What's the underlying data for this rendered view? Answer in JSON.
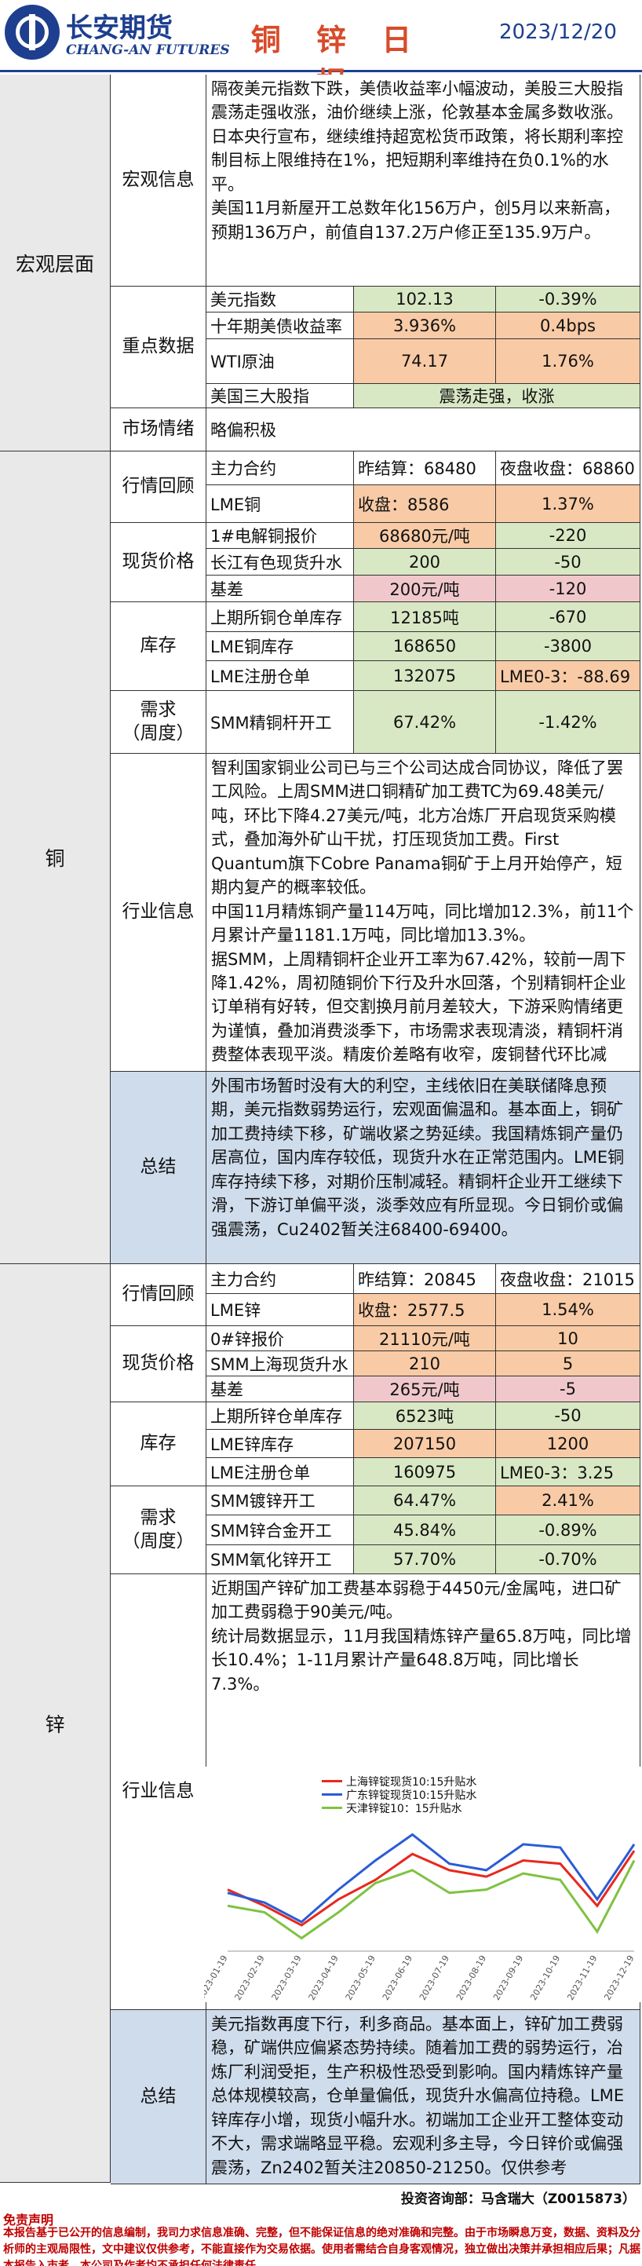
{
  "header": {
    "company_cn": "长安期货",
    "company_en": "CHANG-AN FUTURES",
    "title": "铜 锌 日 报",
    "date": "2023/12/20"
  },
  "macro": {
    "section": "宏观层面",
    "info_label": "宏观信息",
    "info_text": [
      "隔夜美元指数下跌，美债收益率小幅波动，美股三大股指震荡走强收涨，油价继续上涨，伦敦基本金属多数收涨。",
      "日本央行宣布，继续维持超宽松货币政策，将长期利率控制目标上限维持在1%，把短期利率维持在负0.1%的水平。",
      "美国11月新屋开工总数年化156万户，创5月以来新高，预期136万户，前值自137.2万户修正至135.9万户。"
    ],
    "key_label": "重点数据",
    "key_rows": [
      {
        "name": "美元指数",
        "v1": "102.13",
        "v2": "-0.39%"
      },
      {
        "name": "十年期美债收益率",
        "v1": "3.936%",
        "v2": "0.4bps"
      },
      {
        "name": "WTI原油",
        "v1": "74.17",
        "v2": "1.76%"
      }
    ],
    "stocks_name": "美国三大股指",
    "stocks_value": "震荡走强，收涨",
    "sentiment_label": "市场情绪",
    "sentiment_value": "略偏积极"
  },
  "copper": {
    "section": "铜",
    "review_label": "行情回顾",
    "review_head": [
      "主力合约",
      "昨结算：68480",
      "夜盘收盘：68860"
    ],
    "review_lme": [
      "LME铜",
      "收盘：8586",
      "1.37%"
    ],
    "spot_label": "现货价格",
    "spot_rows": [
      [
        "1#电解铜报价",
        "68680元/吨",
        "-220"
      ],
      [
        "长江有色现货升水",
        "200",
        "-50"
      ],
      [
        "基差",
        "200元/吨",
        "-120"
      ]
    ],
    "stock_label": "库存",
    "stock_rows": [
      [
        "上期所铜仓单库存",
        "12185吨",
        "-670"
      ],
      [
        "LME铜库存",
        "168650",
        "-3800"
      ],
      [
        "LME注册仓单",
        "132075",
        "LME0-3：-88.69"
      ]
    ],
    "demand_label": "需求\n（周度）",
    "demand_row": [
      "SMM精铜杆开工",
      "67.42%",
      "-1.42%"
    ],
    "industry_label": "行业信息",
    "industry_text": [
      "智利国家铜业公司已与三个公司达成合同协议，降低了罢工风险。上周SMM进口铜精矿加工费TC为69.48美元/吨，环比下降4.27美元/吨，北方冶炼厂开启现货采购模式，叠加海外矿山干扰，打压现货加工费。First Quantum旗下Cobre Panama铜矿于上月开始停产，短期内复产的概率较低。",
      "中国11月精炼铜产量114万吨，同比增加12.3%，前11个月累计产量1181.1万吨，同比增加13.3%。",
      "据SMM，上周精铜杆企业开工率为67.42%，较前一周下降1.42%，周初随铜价下行及升水回落，个别精铜杆企业订单稍有好转，但交割换月前月差较大，下游采购情绪更为谨慎，叠加消费淡季下，市场需求表现清淡，精铜杆消费整体表现平淡。精废价差略有收窄，废铜替代环比减弱。"
    ],
    "summary_label": "总结",
    "summary_text": "外围市场暂时没有大的利空，主线依旧在美联储降息预期，美元指数弱势运行，宏观面偏温和。基本面上，铜矿加工费持续下移，矿端收紧之势延续。我国精炼铜产量仍居高位，国内库存较低，现货升水在正常范围内。LME铜库存持续下移，对期价压制减轻。精铜杆企业开工继续下滑，下游订单偏平淡，淡季效应有所显现。今日铜价或偏强震荡，Cu2402暂关注68400-69400。"
  },
  "zinc": {
    "section": "锌",
    "review_label": "行情回顾",
    "review_head": [
      "主力合约",
      "昨结算：20845",
      "夜盘收盘：21015"
    ],
    "review_lme": [
      "LME锌",
      "收盘：2577.5",
      "1.54%"
    ],
    "spot_label": "现货价格",
    "spot_rows": [
      [
        "0#锌报价",
        "21110元/吨",
        "10"
      ],
      [
        "SMM上海现货升水",
        "210",
        "5"
      ],
      [
        "基差",
        "265元/吨",
        "-5"
      ]
    ],
    "stock_label": "库存",
    "stock_rows": [
      [
        "上期所锌仓单库存",
        "6523吨",
        "-50"
      ],
      [
        "LME锌库存",
        "207150",
        "1200"
      ],
      [
        "LME注册仓单",
        "160975",
        "LME0-3：3.25"
      ]
    ],
    "demand_label": "需求\n（周度）",
    "demand_rows": [
      [
        "SMM镀锌开工",
        "64.47%",
        "2.41%"
      ],
      [
        "SMM锌合金开工",
        "45.84%",
        "-0.89%"
      ],
      [
        "SMM氧化锌开工",
        "57.70%",
        "-0.70%"
      ]
    ],
    "industry_label": "行业信息",
    "industry_text": [
      "近期国产锌矿加工费基本弱稳于4450元/金属吨，进口矿加工费弱稳于90美元/吨。",
      "统计局数据显示，11月我国精炼锌产量65.8万吨，同比增长10.4%；1-11月累计产量648.8万吨，同比增长7.3%。"
    ],
    "summary_label": "总结",
    "summary_text": "美元指数再度下行，利多商品。基本面上，锌矿加工费弱稳，矿端供应偏紧态势持续。随着加工费的弱势运行，冶炼厂利润受拒，生产积极性恐受到影响。国内精炼锌产量总体规模较高，仓单量偏低，现货升水偏高位持稳。LME锌库存小增，现货小幅升水。初端加工企业开工整体变动不大，需求端略显平稳。宏观利多主导，今日锌价或偏强震荡，Zn2402暂关注20850-21250。仅供参考"
  },
  "chart_data": {
    "type": "line",
    "title": "",
    "xlabel": "",
    "ylabel": "",
    "x": [
      "2023-01-19",
      "2023-02-19",
      "2023-03-19",
      "2023-04-19",
      "2023-05-19",
      "2023-06-19",
      "2023-07-19",
      "2023-08-19",
      "2023-09-19",
      "2023-10-19",
      "2023-11-19",
      "2023-12-19"
    ],
    "ylim": [
      -100,
      300
    ],
    "series": [
      {
        "name": "上海锌锭现货10:15升贴水",
        "color": "#e8281e",
        "values": [
          90,
          40,
          -20,
          60,
          120,
          200,
          150,
          130,
          180,
          170,
          40,
          210
        ]
      },
      {
        "name": "广东锌锭现货10:15升贴水",
        "color": "#2a5cd6",
        "values": [
          80,
          50,
          -10,
          90,
          180,
          260,
          170,
          150,
          230,
          220,
          60,
          230
        ]
      },
      {
        "name": "天津锌锭10：15升贴水",
        "color": "#7fc241",
        "values": [
          40,
          20,
          -60,
          20,
          110,
          150,
          80,
          90,
          140,
          120,
          -40,
          180
        ]
      }
    ]
  },
  "footer": {
    "analyst": "投资咨询部：马含瑞大（Z0015873）",
    "disclaimer_title": "免责声明",
    "disclaimer": "本报告基于已公开的信息编制，我司力求信息准确、完整，但不能保证信息的绝对准确和完整。由于市场瞬息万变，数据、资料及分析师的主观局限性，文中建议仅供参考，不能直接作为交易依据。使用者需结合自身客观情况，独立做出决策并承担相应后果；凡据本报告入市者，本公司及作者均不承担任何法律责任。"
  }
}
